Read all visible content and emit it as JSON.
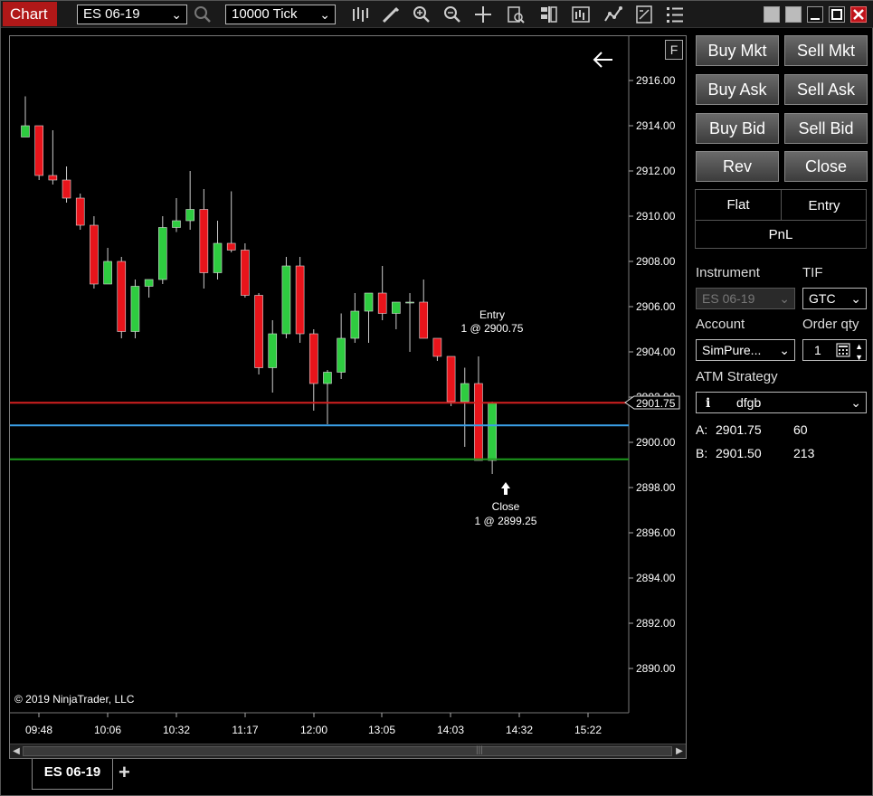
{
  "window": {
    "title": "Chart",
    "instrument_select": "ES 06-19",
    "interval_select": "10000 Tick"
  },
  "colors": {
    "up": "#2ecc40",
    "down": "#e8141b",
    "entry_line": "#d42020",
    "last_line": "#3aa0e8",
    "close_line": "#1c9a1c",
    "title_red": "#b01818"
  },
  "chart": {
    "copyright": "© 2019 NinjaTrader, LLC",
    "f_label": "F",
    "y_ticks": [
      "2916.00",
      "2914.00",
      "2912.00",
      "2910.00",
      "2908.00",
      "2906.00",
      "2904.00",
      "2902.00",
      "2900.00",
      "2898.00",
      "2896.00",
      "2894.00",
      "2892.00",
      "2890.00"
    ],
    "x_ticks": [
      "09:48",
      "10:06",
      "10:32",
      "11:17",
      "12:00",
      "13:05",
      "14:03",
      "14:32",
      "15:22"
    ],
    "price_tag": "2901.75",
    "entry_price": 2901.75,
    "last_price": 2900.75,
    "close_price": 2899.25,
    "entry_label_1": "Entry",
    "entry_label_2": "1 @ 2900.75",
    "close_label_1": "Close",
    "close_label_2": "1 @ 2899.25"
  },
  "chart_data": {
    "type": "candlestick",
    "ylim": [
      2888.0,
      2918.0
    ],
    "candles": [
      {
        "o": 2913.5,
        "h": 2915.3,
        "l": 2914.0,
        "c": 2914.0
      },
      {
        "o": 2914.0,
        "h": 2914.0,
        "l": 2911.6,
        "c": 2911.8
      },
      {
        "o": 2911.8,
        "h": 2913.8,
        "l": 2911.4,
        "c": 2911.6
      },
      {
        "o": 2911.6,
        "h": 2912.2,
        "l": 2910.6,
        "c": 2910.8
      },
      {
        "o": 2910.8,
        "h": 2911.0,
        "l": 2909.4,
        "c": 2909.6
      },
      {
        "o": 2909.6,
        "h": 2910.0,
        "l": 2906.8,
        "c": 2907.0
      },
      {
        "o": 2907.0,
        "h": 2908.6,
        "l": 2907.0,
        "c": 2908.0
      },
      {
        "o": 2908.0,
        "h": 2908.2,
        "l": 2904.6,
        "c": 2904.9
      },
      {
        "o": 2904.9,
        "h": 2907.2,
        "l": 2904.6,
        "c": 2906.9
      },
      {
        "o": 2906.9,
        "h": 2907.2,
        "l": 2906.4,
        "c": 2907.2
      },
      {
        "o": 2907.2,
        "h": 2910.0,
        "l": 2907.0,
        "c": 2909.5
      },
      {
        "o": 2909.5,
        "h": 2910.8,
        "l": 2909.3,
        "c": 2909.8
      },
      {
        "o": 2909.8,
        "h": 2912.0,
        "l": 2909.4,
        "c": 2910.3
      },
      {
        "o": 2910.3,
        "h": 2911.2,
        "l": 2906.8,
        "c": 2907.5
      },
      {
        "o": 2907.5,
        "h": 2909.8,
        "l": 2907.2,
        "c": 2908.8
      },
      {
        "o": 2908.8,
        "h": 2911.1,
        "l": 2908.4,
        "c": 2908.5
      },
      {
        "o": 2908.5,
        "h": 2908.8,
        "l": 2906.4,
        "c": 2906.5
      },
      {
        "o": 2906.5,
        "h": 2906.6,
        "l": 2903.0,
        "c": 2903.3
      },
      {
        "o": 2903.3,
        "h": 2905.4,
        "l": 2902.2,
        "c": 2904.8
      },
      {
        "o": 2904.8,
        "h": 2908.2,
        "l": 2904.6,
        "c": 2907.8
      },
      {
        "o": 2907.8,
        "h": 2908.2,
        "l": 2904.4,
        "c": 2904.8
      },
      {
        "o": 2904.8,
        "h": 2905.0,
        "l": 2901.4,
        "c": 2902.6
      },
      {
        "o": 2902.6,
        "h": 2903.2,
        "l": 2900.8,
        "c": 2903.1
      },
      {
        "o": 2903.1,
        "h": 2905.7,
        "l": 2902.8,
        "c": 2904.6
      },
      {
        "o": 2904.6,
        "h": 2906.6,
        "l": 2904.4,
        "c": 2905.8
      },
      {
        "o": 2905.8,
        "h": 2906.6,
        "l": 2904.4,
        "c": 2906.6
      },
      {
        "o": 2906.6,
        "h": 2907.8,
        "l": 2905.4,
        "c": 2905.7
      },
      {
        "o": 2905.7,
        "h": 2906.2,
        "l": 2905.0,
        "c": 2906.2
      },
      {
        "o": 2906.2,
        "h": 2906.6,
        "l": 2904.0,
        "c": 2906.2
      },
      {
        "o": 2906.2,
        "h": 2907.2,
        "l": 2904.6,
        "c": 2904.6
      },
      {
        "o": 2904.6,
        "h": 2904.6,
        "l": 2903.6,
        "c": 2903.8
      },
      {
        "o": 2903.8,
        "h": 2903.8,
        "l": 2901.6,
        "c": 2901.8
      },
      {
        "o": 2901.8,
        "h": 2903.3,
        "l": 2899.8,
        "c": 2902.6
      },
      {
        "o": 2902.6,
        "h": 2903.8,
        "l": 2899.2,
        "c": 2899.2
      },
      {
        "o": 2899.2,
        "h": 2901.8,
        "l": 2898.6,
        "c": 2901.75
      }
    ]
  },
  "trade_panel": {
    "buy_mkt": "Buy Mkt",
    "sell_mkt": "Sell Mkt",
    "buy_ask": "Buy Ask",
    "sell_ask": "Sell Ask",
    "buy_bid": "Buy Bid",
    "sell_bid": "Sell Bid",
    "rev": "Rev",
    "close": "Close",
    "flat": "Flat",
    "entry": "Entry",
    "pnl": "PnL",
    "instrument_label": "Instrument",
    "tif_label": "TIF",
    "instrument_value": "ES 06-19",
    "tif_value": "GTC",
    "account_label": "Account",
    "order_qty_label": "Order qty",
    "account_value": "SimPure...",
    "order_qty_value": "1",
    "atm_label": "ATM Strategy",
    "atm_value": "dfgb",
    "ask_label": "A:",
    "ask_price": "2901.75",
    "ask_size": "60",
    "bid_label": "B:",
    "bid_price": "2901.50",
    "bid_size": "213"
  },
  "tabs": {
    "active": "ES 06-19",
    "add": "+"
  }
}
